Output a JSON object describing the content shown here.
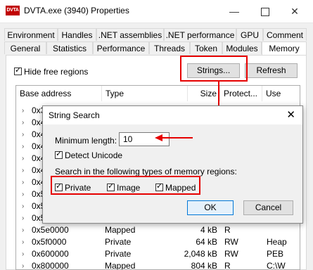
{
  "window": {
    "icon_text": "DVTA",
    "title": "DVTA.exe (3940) Properties",
    "minimize": "—",
    "close": "✕"
  },
  "tabs_row1": [
    "Environment",
    "Handles",
    ".NET assemblies",
    ".NET performance",
    "GPU",
    "Comment"
  ],
  "tabs_row2": [
    "General",
    "Statistics",
    "Performance",
    "Threads",
    "Token",
    "Modules",
    "Memory"
  ],
  "active_tab": "Memory",
  "toolbar": {
    "hide_free_label": "Hide free regions",
    "hide_free_checked": true,
    "strings_button": "Strings...",
    "refresh_button": "Refresh"
  },
  "list": {
    "columns": [
      "Base address",
      "Type",
      "Size",
      "Protect...",
      "Use"
    ],
    "rows": [
      {
        "addr": "0x3e",
        "type": "",
        "size": "",
        "protect": "",
        "use": ""
      },
      {
        "addr": "0x42",
        "type": "",
        "size": "",
        "protect": "",
        "use": ""
      },
      {
        "addr": "0x43",
        "type": "",
        "size": "",
        "protect": "",
        "use": ""
      },
      {
        "addr": "0x44",
        "type": "",
        "size": "",
        "protect": "",
        "use": ""
      },
      {
        "addr": "0x45",
        "type": "",
        "size": "",
        "protect": "",
        "use": ""
      },
      {
        "addr": "0x47",
        "type": "",
        "size": "",
        "protect": "",
        "use": ""
      },
      {
        "addr": "0x4b",
        "type": "",
        "size": "",
        "protect": "",
        "use": ""
      },
      {
        "addr": "0x5b",
        "type": "",
        "size": "",
        "protect": "",
        "use": ""
      },
      {
        "addr": "0x5c",
        "type": "",
        "size": "",
        "protect": "",
        "use": ""
      },
      {
        "addr": "0x5d",
        "type": "",
        "size": "",
        "protect": "",
        "use": ""
      },
      {
        "addr": "0x5e0000",
        "type": "Mapped",
        "size": "4 kB",
        "protect": "R",
        "use": ""
      },
      {
        "addr": "0x5f0000",
        "type": "Private",
        "size": "64 kB",
        "protect": "RW",
        "use": "Heap"
      },
      {
        "addr": "0x600000",
        "type": "Private",
        "size": "2,048 kB",
        "protect": "RW",
        "use": "PEB"
      },
      {
        "addr": "0x800000",
        "type": "Mapped",
        "size": "804 kB",
        "protect": "R",
        "use": "C:\\W"
      }
    ]
  },
  "dialog": {
    "title": "String Search",
    "close": "✕",
    "min_length_label": "Minimum length:",
    "min_length_value": "10",
    "detect_unicode_label": "Detect Unicode",
    "detect_unicode_checked": true,
    "search_types_label": "Search in the following types of memory regions:",
    "types": [
      {
        "label": "Private",
        "checked": true
      },
      {
        "label": "Image",
        "checked": true
      },
      {
        "label": "Mapped",
        "checked": true
      }
    ],
    "ok_button": "OK",
    "cancel_button": "Cancel"
  },
  "colors": {
    "highlight_red": "#e60000",
    "app_icon_red": "#c00000",
    "default_button_border": "#0078d7"
  }
}
